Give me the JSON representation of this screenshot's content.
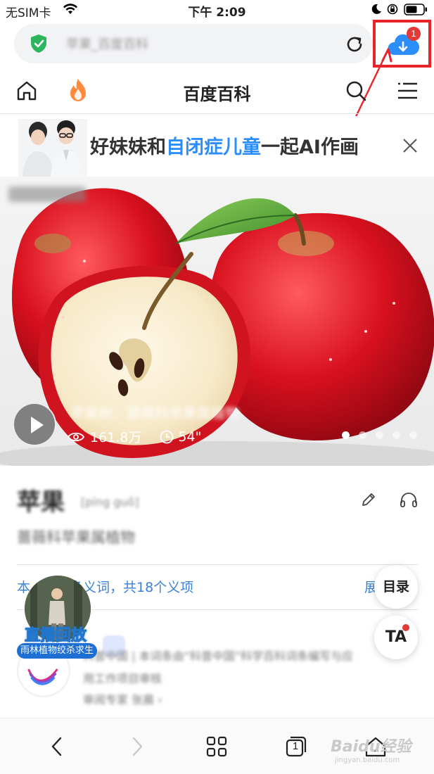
{
  "status_bar": {
    "carrier": "无SIM卡",
    "time": "下午 2:09"
  },
  "url_bar": {
    "url_text": "苹果_百度百科",
    "download_badge": "1"
  },
  "nav": {
    "title": "百度百科"
  },
  "banner": {
    "text_before": "好妹妹和",
    "text_highlight": "自闭症儿童",
    "text_after": "一起AI作画"
  },
  "hero": {
    "caption": "苹果树：蔷薇科苹果属植物",
    "views": "161.8万",
    "duration": "54\"",
    "slide_count": 5,
    "active_slide": 0
  },
  "entry": {
    "name": "苹果",
    "pinyin": "[píng guǒ]",
    "summary": "蔷薇科苹果属植物",
    "polysemy_prefix": "本",
    "polysemy_text": "多义词，共18个义项",
    "polysemy_expand": "展"
  },
  "live_badge": {
    "label": "直播回放",
    "sub": "雨林植物绞杀求生"
  },
  "fabs": {
    "toc": "目录",
    "ta": "TA"
  },
  "author": {
    "line1": "科普中国 | 本词条由“科普中国”科学百科词条编写与应",
    "line2": "用工作项目审核",
    "line3": "审阅专家 张晨 ›"
  },
  "toolbar": {
    "tabs_count": "1",
    "watermark": "Baidu经验",
    "watermark_sub": "jingyan.baidu.com"
  },
  "colors": {
    "accent_blue": "#2c8ef8",
    "highlight_red": "#e8242a",
    "link_blue": "#3a82d8"
  }
}
